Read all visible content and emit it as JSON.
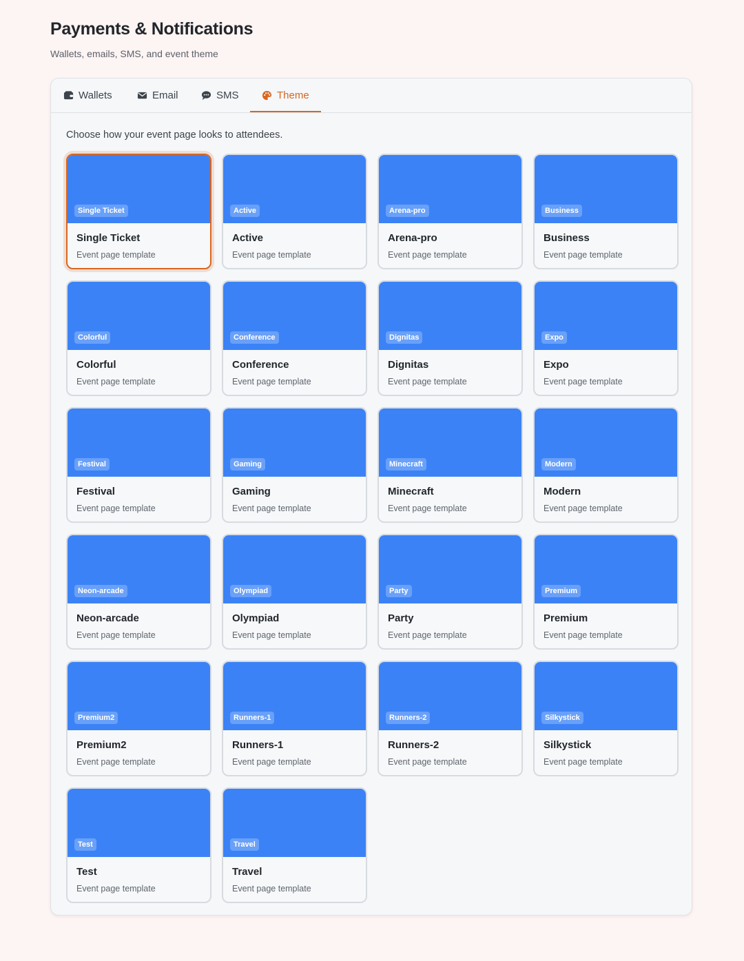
{
  "header": {
    "title": "Payments & Notifications",
    "subtitle": "Wallets, emails, SMS, and event theme"
  },
  "tabs": [
    {
      "label": "Wallets",
      "icon": "wallet-icon"
    },
    {
      "label": "Email",
      "icon": "envelope-icon"
    },
    {
      "label": "SMS",
      "icon": "sms-icon"
    },
    {
      "label": "Theme",
      "icon": "palette-icon",
      "active": true
    }
  ],
  "theme": {
    "intro": "Choose how your event page looks to attendees.",
    "selected": "Single Ticket",
    "template_subtitle": "Event page template",
    "thumbnail_color": "#3b82f6",
    "accent_color": "#d9661f",
    "templates": [
      {
        "name": "Single Ticket",
        "tag": "Single Ticket"
      },
      {
        "name": "Active",
        "tag": "Active"
      },
      {
        "name": "Arena-pro",
        "tag": "Arena-pro"
      },
      {
        "name": "Business",
        "tag": "Business"
      },
      {
        "name": "Colorful",
        "tag": "Colorful"
      },
      {
        "name": "Conference",
        "tag": "Conference"
      },
      {
        "name": "Dignitas",
        "tag": "Dignitas"
      },
      {
        "name": "Expo",
        "tag": "Expo"
      },
      {
        "name": "Festival",
        "tag": "Festival"
      },
      {
        "name": "Gaming",
        "tag": "Gaming"
      },
      {
        "name": "Minecraft",
        "tag": "Minecraft"
      },
      {
        "name": "Modern",
        "tag": "Modern"
      },
      {
        "name": "Neon-arcade",
        "tag": "Neon-arcade"
      },
      {
        "name": "Olympiad",
        "tag": "Olympiad"
      },
      {
        "name": "Party",
        "tag": "Party"
      },
      {
        "name": "Premium",
        "tag": "Premium"
      },
      {
        "name": "Premium2",
        "tag": "Premium2"
      },
      {
        "name": "Runners-1",
        "tag": "Runners-1"
      },
      {
        "name": "Runners-2",
        "tag": "Runners-2"
      },
      {
        "name": "Silkystick",
        "tag": "Silkystick"
      },
      {
        "name": "Test",
        "tag": "Test"
      },
      {
        "name": "Travel",
        "tag": "Travel"
      }
    ]
  }
}
